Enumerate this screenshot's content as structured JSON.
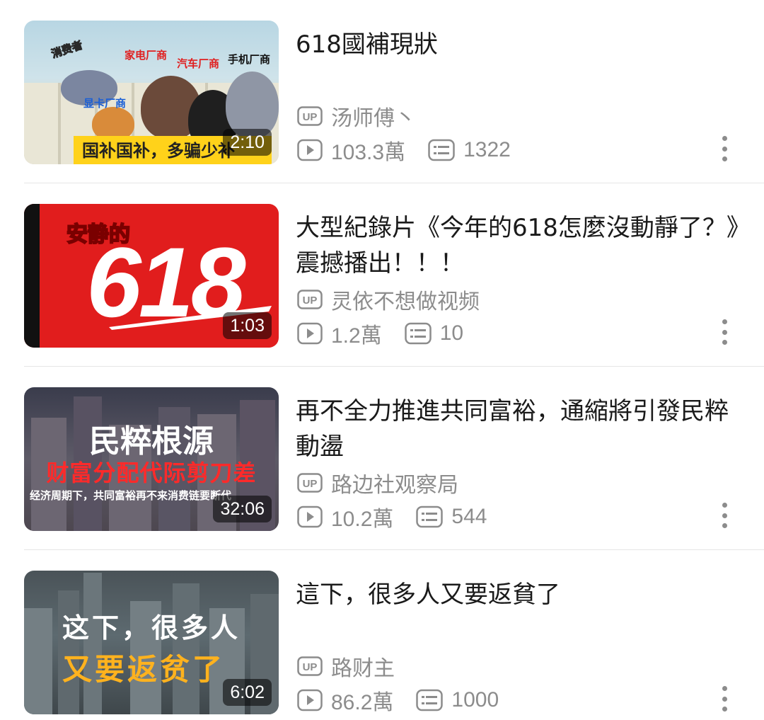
{
  "videos": [
    {
      "title": "618國補現狀",
      "uploader": "汤师傅丶",
      "views": "103.3萬",
      "comments": "1322",
      "duration": "2:10",
      "thumb": {
        "labels": [
          "消费者",
          "家电厂商",
          "汽车厂商",
          "手机厂商",
          "显卡厂商"
        ],
        "banner": "国补国补，多骗少补"
      }
    },
    {
      "title": "大型紀錄片《今年的618怎麼沒動靜了？》震撼播出！！！",
      "uploader": "灵依不想做视频",
      "views": "1.2萬",
      "comments": "10",
      "duration": "1:03",
      "thumb": {
        "tag": "安静的",
        "big": "618"
      }
    },
    {
      "title": "再不全力推進共同富裕，通縮將引發民粹動盪",
      "uploader": "路边社观察局",
      "views": "10.2萬",
      "comments": "544",
      "duration": "32:06",
      "thumb": {
        "line1": "民粹根源",
        "line2": "财富分配代际剪刀差",
        "line3": "经济周期下，共同富裕再不来消费链要断代"
      }
    },
    {
      "title": "這下，很多人又要返貧了",
      "uploader": "路财主",
      "views": "86.2萬",
      "comments": "1000",
      "duration": "6:02",
      "thumb": {
        "line1": "这下，很多人",
        "line2": "又要返贫了"
      }
    }
  ],
  "icons": {
    "uploader": "up-badge-icon",
    "views": "play-icon",
    "comments": "danmaku-icon",
    "more": "more-vertical-icon"
  },
  "colors": {
    "title": "#1a1a1a",
    "meta": "#8c8c8c",
    "divider": "#e6e6e6"
  }
}
